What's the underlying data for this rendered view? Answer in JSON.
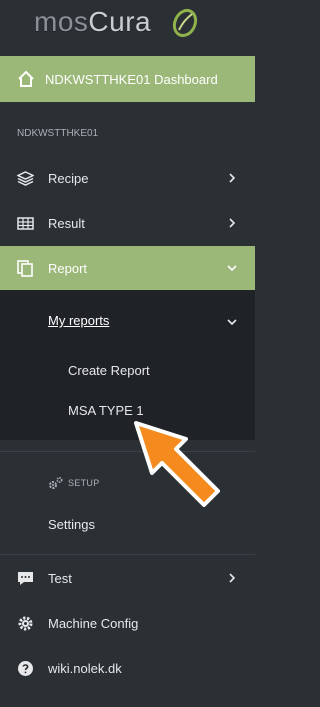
{
  "logo": {
    "part1": "mos",
    "part2": "Cura"
  },
  "dashboard": {
    "label": "NDKWSTTHKE01 Dashboard",
    "icon": "home-icon"
  },
  "section": {
    "label": "NDKWSTTHKE01"
  },
  "menu": {
    "recipe": {
      "label": "Recipe",
      "icon": "layers-icon"
    },
    "result": {
      "label": "Result",
      "icon": "table-icon"
    },
    "report": {
      "label": "Report",
      "icon": "copy-icon"
    }
  },
  "submenu": {
    "my_reports": "My reports",
    "create_report": "Create Report",
    "msa_type": "MSA TYPE 1"
  },
  "setup": {
    "label": "SETUP",
    "icon": "gears-icon"
  },
  "settings": {
    "label": "Settings"
  },
  "bottom": {
    "test": {
      "label": "Test",
      "icon": "comment-icon"
    },
    "machine_config": {
      "label": "Machine Config",
      "icon": "cog-icon"
    },
    "wiki": {
      "label": "wiki.nolek.dk",
      "icon": "question-icon"
    }
  },
  "colors": {
    "sidebar_bg": "#2b3035",
    "active_green": "#9bb879",
    "submenu_bg": "#1f2327",
    "arrow_orange": "#f58a1f"
  }
}
